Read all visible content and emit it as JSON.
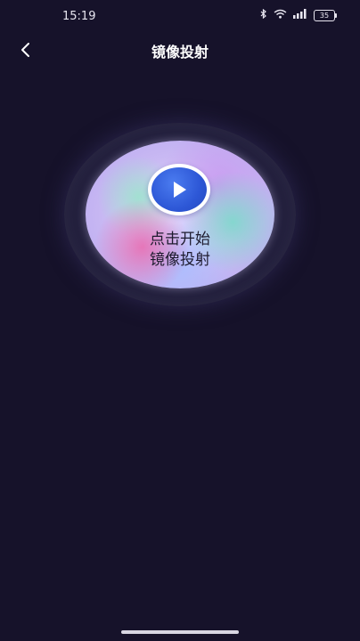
{
  "status_bar": {
    "time": "15:19",
    "battery": "35"
  },
  "header": {
    "title": "镜像投射"
  },
  "mirror_button": {
    "label_line1": "点击开始",
    "label_line2": "镜像投射"
  }
}
